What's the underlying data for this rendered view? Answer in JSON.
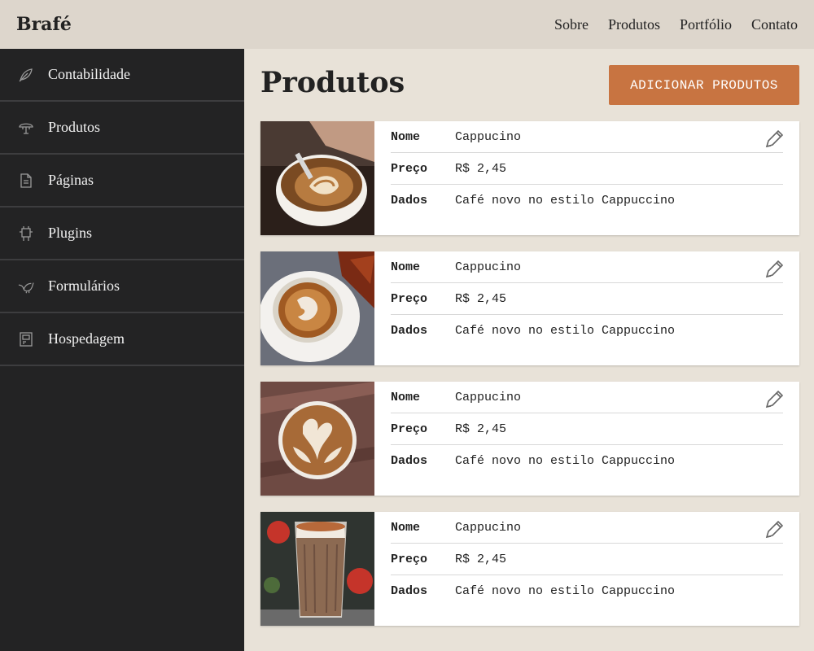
{
  "brand": "Brafé",
  "nav": [
    "Sobre",
    "Produtos",
    "Portfólio",
    "Contato"
  ],
  "sidebar": {
    "items": [
      {
        "label": "Contabilidade",
        "icon": "leaf-icon"
      },
      {
        "label": "Produtos",
        "icon": "umbrella-icon"
      },
      {
        "label": "Páginas",
        "icon": "document-icon"
      },
      {
        "label": "Plugins",
        "icon": "plugin-icon"
      },
      {
        "label": "Formulários",
        "icon": "bird-icon"
      },
      {
        "label": "Hospedagem",
        "icon": "server-icon"
      }
    ]
  },
  "main": {
    "title": "Produtos",
    "add_button": "ADICIONAR PRODUTOS",
    "labels": {
      "name": "Nome",
      "price": "Preço",
      "data": "Dados"
    },
    "products": [
      {
        "name": "Cappucino",
        "price": "R$ 2,45",
        "data": "Café novo no estilo Cappuccino"
      },
      {
        "name": "Cappucino",
        "price": "R$ 2,45",
        "data": "Café novo no estilo Cappuccino"
      },
      {
        "name": "Cappucino",
        "price": "R$ 2,45",
        "data": "Café novo no estilo Cappuccino"
      },
      {
        "name": "Cappucino",
        "price": "R$ 2,45",
        "data": "Café novo no estilo Cappuccino"
      }
    ]
  },
  "colors": {
    "accent": "#c87441",
    "sidebar_bg": "#232324",
    "topbar_bg": "#ddd6cc",
    "page_bg": "#e8e2d8"
  }
}
